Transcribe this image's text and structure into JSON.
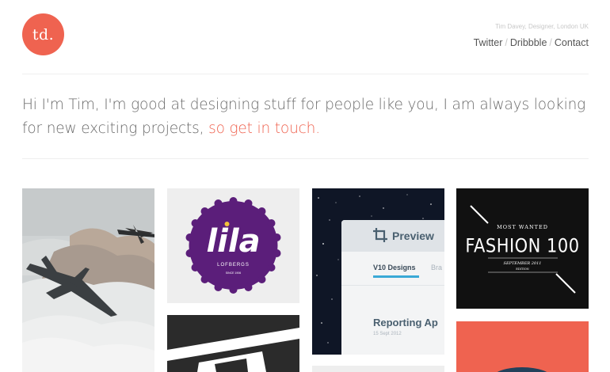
{
  "header": {
    "logo_text": "td.",
    "tagline": "Tim Davey, Designer, London UK",
    "nav": [
      {
        "label": "Twitter"
      },
      {
        "label": "Dribbble"
      },
      {
        "label": "Contact"
      }
    ],
    "separator": "/"
  },
  "intro": {
    "text": "Hi I'm Tim, I'm good at designing stuff for people like you, I am always looking for new exciting projects, ",
    "cta": "so get in touch."
  },
  "portfolio": {
    "lila": {
      "title": "lila",
      "subtitle": "LOFBERGS",
      "small": "SINCE 1906"
    },
    "preview": {
      "app_title": "Preview",
      "tab_active": "V10 Designs",
      "tab_next": "Bra",
      "heading": "Reporting Ap",
      "date": "15 Sept 2012"
    },
    "fashion": {
      "kicker": "MOST WANTED",
      "title": "FASHION 100",
      "subtitle": "SEPTEMBER 2011",
      "edition": "EDITION"
    }
  },
  "colors": {
    "accent": "#ef6350",
    "lila_purple": "#5b1e7a",
    "preview_blue": "#3aa9d6",
    "fashion_bg": "#111111"
  },
  "icons": {
    "preview_icon": "crop-icon"
  }
}
